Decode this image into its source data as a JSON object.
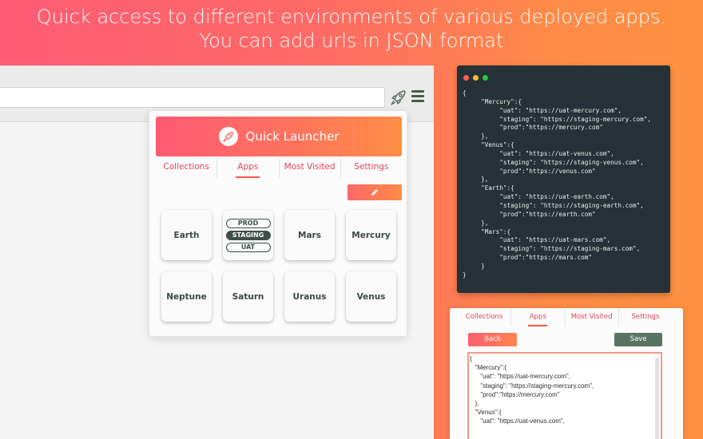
{
  "headline": {
    "line1": "Quick access to different environments of various deployed apps.",
    "line2": "You can add urls in JSON format"
  },
  "browser": {
    "toolbar_icons": [
      "rocket-icon",
      "hamburger-menu-icon"
    ]
  },
  "launcher": {
    "title": "Quick Launcher",
    "logo_icon": "rocket-icon",
    "tabs": [
      {
        "label": "Collections",
        "active": false
      },
      {
        "label": "Apps",
        "active": true
      },
      {
        "label": "Most Visited",
        "active": false
      },
      {
        "label": "Settings",
        "active": false
      }
    ],
    "edit_icon": "pencil-icon",
    "apps": [
      {
        "name": "Earth"
      },
      {
        "name": "",
        "envs": [
          "PROD",
          "STAGING",
          "UAT"
        ],
        "hovered_env": "STAGING"
      },
      {
        "name": "Mars"
      },
      {
        "name": "Mercury"
      },
      {
        "name": "Neptune"
      },
      {
        "name": "Saturn"
      },
      {
        "name": "Uranus"
      },
      {
        "name": "Venus"
      }
    ]
  },
  "code_panel": {
    "window_dots": [
      "#ff5f56",
      "#ffbd2e",
      "#27c93f"
    ],
    "code": "{\n     \"Mercury\":{\n          \"uat\": \"https://uat-mercury.com\",\n          \"staging\": \"https://staging-mercury.com\",\n          \"prod\":\"https://mercury.com\"\n     },\n     \"Venus\":{\n          \"uat\": \"https://uat-venus.com\",\n          \"staging\": \"https://staging-venus.com\",\n          \"prod\":\"https://venus.com\"\n     },\n     \"Earth\":{\n          \"uat\": \"https://uat-earth.com\",\n          \"staging\": \"https://staging-earth.com\",\n          \"prod\":\"https://earth.com\"\n     },\n     \"Mars\":{\n          \"uat\": \"https://uat-mars.com\",\n          \"staging\": \"https://staging-mars.com\",\n          \"prod\":\"https://mars.com\"\n     }\n}"
  },
  "settings_panel": {
    "tabs": [
      {
        "label": "Collections",
        "active": false
      },
      {
        "label": "Apps",
        "active": true
      },
      {
        "label": "Most Visited",
        "active": false
      },
      {
        "label": "Settings",
        "active": false
      }
    ],
    "back_label": "Back",
    "save_label": "Save",
    "json_value": "{\n   \"Mercury\":{\n      \"uat\": \"https://uat-mercury.com\",\n      \"staging\": \"https://staging-mercury.com\",\n      \"prod\":\"https://mercury.com\"\n   },\n   \"Venus\":{\n      \"uat\": \"https://uat-venus.com\","
  },
  "colors": {
    "accent_red": "#fe5b74",
    "accent_orange": "#fe9140",
    "code_bg": "#263238",
    "save_green": "#5a7463"
  }
}
